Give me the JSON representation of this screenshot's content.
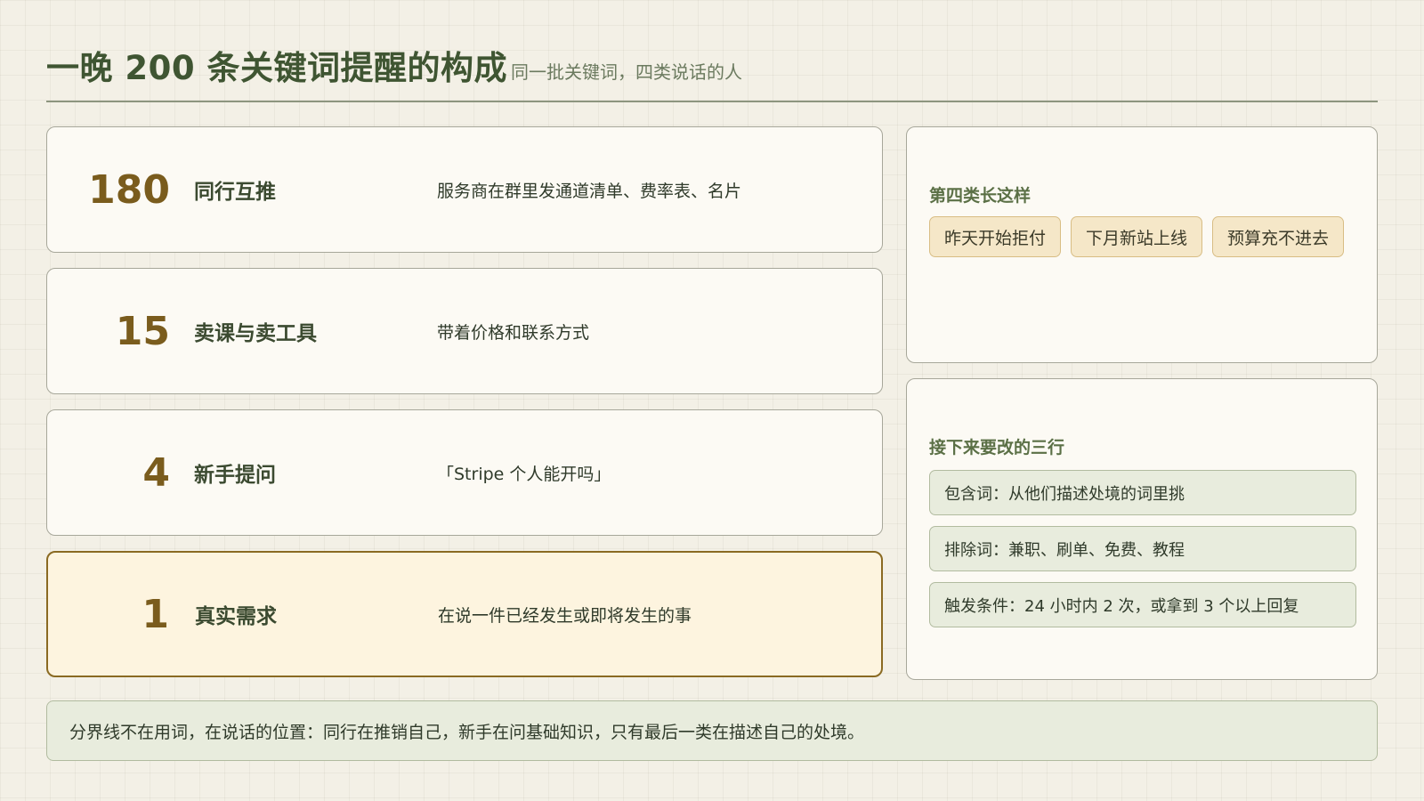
{
  "header": {
    "title": "一晚 200 条关键词提醒的构成",
    "subtitle": "同一批关键词，四类说话的人"
  },
  "breakdown": [
    {
      "count": "180",
      "label": "同行互推",
      "desc": "服务商在群里发通道清单、费率表、名片",
      "highlight": false
    },
    {
      "count": "15",
      "label": "卖课与卖工具",
      "desc": "带着价格和联系方式",
      "highlight": false
    },
    {
      "count": "4",
      "label": "新手提问",
      "desc": "「Stripe 个人能开吗」",
      "highlight": false
    },
    {
      "count": "1",
      "label": "真实需求",
      "desc": "在说一件已经发生或即将发生的事",
      "highlight": true
    }
  ],
  "examples_panel": {
    "title": "第四类长这样",
    "tags": [
      "昨天开始拒付",
      "下月新站上线",
      "预算充不进去"
    ]
  },
  "changes_panel": {
    "title": "接下来要改的三行",
    "rules": [
      "包含词：从他们描述处境的词里挑",
      "排除词：兼职、刷单、免费、教程",
      "触发条件：24 小时内 2 次，或拿到 3 个以上回复"
    ]
  },
  "footer": {
    "text": "分界线不在用词，在说话的位置：同行在推销自己，新手在问基础知识，只有最后一类在描述自己的处境。"
  },
  "colors": {
    "accent_green": "#3f5532",
    "accent_brown": "#7a5c1d",
    "highlight_bg": "#fdf4df",
    "tag_bg": "#f5e7c8",
    "rule_bg": "#e8ecdd"
  }
}
